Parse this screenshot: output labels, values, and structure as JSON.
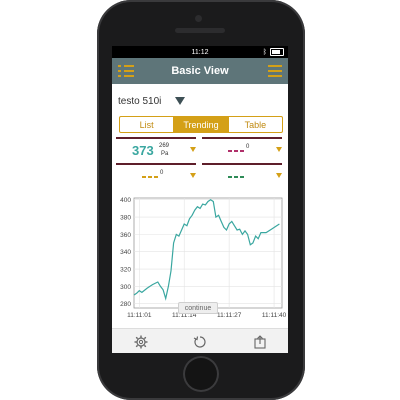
{
  "status_bar": {
    "time": "11:12",
    "bluetooth": "bluetooth-icon",
    "battery": "battery-icon"
  },
  "nav": {
    "title": "Basic View"
  },
  "device": {
    "name": "testo 510i"
  },
  "tabs": [
    {
      "label": "List",
      "active": false
    },
    {
      "label": "Trending",
      "active": true
    },
    {
      "label": "Table",
      "active": false
    }
  ],
  "tiles": {
    "t1": {
      "value": "373",
      "small_top": "269",
      "unit": "Pa",
      "accent": "#3aa7a0"
    },
    "t2": {
      "value": "0",
      "dash_color": "#b0306a"
    },
    "t3": {
      "value": "0",
      "dash_color": "#d4a017"
    },
    "t4": {
      "dash_color": "#2e8b57"
    }
  },
  "chart_data": {
    "type": "line",
    "x_ticks": [
      "11:11:01",
      "11:11:14",
      "11:11:27",
      "11:11:40"
    ],
    "y_ticks": [
      280,
      300,
      320,
      340,
      360,
      380,
      400
    ],
    "ylim": [
      275,
      402
    ],
    "xlim": [
      0,
      56
    ],
    "grid": true,
    "series": [
      {
        "color": "#3aa7a0",
        "x": [
          0,
          1,
          2,
          3,
          5,
          7,
          9,
          10,
          11,
          12,
          13,
          14,
          15,
          16,
          17,
          18,
          19,
          20,
          21,
          22,
          23,
          24,
          25,
          26,
          27,
          28,
          29,
          30,
          31,
          32,
          33,
          34,
          35,
          36,
          37,
          38,
          39,
          40,
          41,
          42,
          43,
          44,
          45,
          46,
          47,
          48,
          50,
          52,
          54,
          55
        ],
        "y": [
          290,
          292,
          295,
          293,
          298,
          302,
          305,
          300,
          296,
          286,
          300,
          318,
          350,
          360,
          358,
          365,
          372,
          370,
          378,
          382,
          388,
          392,
          390,
          395,
          394,
          398,
          400,
          398,
          380,
          382,
          375,
          368,
          365,
          372,
          375,
          370,
          365,
          366,
          360,
          364,
          360,
          348,
          350,
          358,
          355,
          362,
          362,
          366,
          370,
          372
        ]
      }
    ]
  },
  "chart": {
    "continue_label": "continue"
  },
  "bottom": {
    "settings": "gear-icon",
    "refresh": "refresh-icon",
    "share": "share-icon"
  }
}
